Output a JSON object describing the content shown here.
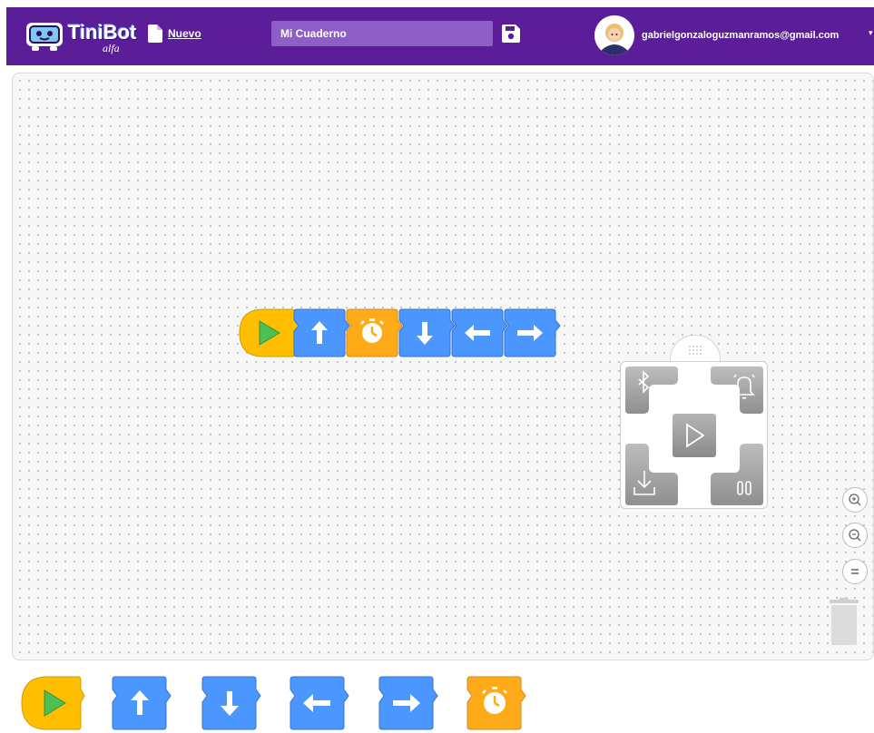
{
  "header": {
    "logo_text": "TiniBot",
    "logo_subtext": "alfa",
    "new_label": "Nuevo",
    "notebook_name": "Mi Cuaderno",
    "user_email": "gabrielgonzaloguzmanramos@gmail.com"
  },
  "colors": {
    "header_bg": "#5b1d98",
    "start_block": "#ffbf00",
    "motion_block": "#4c97ff",
    "wait_block": "#ffab19",
    "play_green": "#4cbf56",
    "remote_button": "#9e9e9e"
  },
  "script_blocks": [
    {
      "type": "start",
      "icon": "play-icon"
    },
    {
      "type": "move",
      "icon": "arrow-up-icon"
    },
    {
      "type": "wait",
      "icon": "stopwatch-icon"
    },
    {
      "type": "move",
      "icon": "arrow-down-icon"
    },
    {
      "type": "move",
      "icon": "arrow-left-icon"
    },
    {
      "type": "move",
      "icon": "arrow-right-icon"
    }
  ],
  "remote": {
    "buttons": [
      "bluetooth-icon",
      "bell-icon",
      "play-icon",
      "download-icon",
      "pause-icon"
    ]
  },
  "zoom_controls": [
    "zoom-in-icon",
    "zoom-out-icon",
    "zoom-reset-icon"
  ],
  "toolbox_blocks": [
    {
      "type": "start",
      "icon": "play-icon"
    },
    {
      "type": "move",
      "icon": "arrow-up-icon"
    },
    {
      "type": "move",
      "icon": "arrow-down-icon"
    },
    {
      "type": "move",
      "icon": "arrow-left-icon"
    },
    {
      "type": "move",
      "icon": "arrow-right-icon"
    },
    {
      "type": "wait",
      "icon": "stopwatch-icon"
    }
  ]
}
